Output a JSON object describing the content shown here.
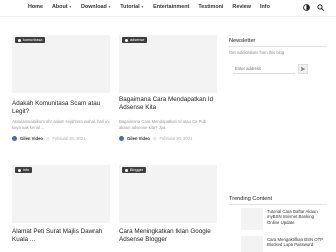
{
  "nav": {
    "items": [
      {
        "label": "Home",
        "dropdown": false
      },
      {
        "label": "About",
        "dropdown": true
      },
      {
        "label": "Download",
        "dropdown": true
      },
      {
        "label": "Tutorial",
        "dropdown": true
      },
      {
        "label": "Entertainment",
        "dropdown": false
      },
      {
        "label": "Testimoni",
        "dropdown": false
      },
      {
        "label": "Review",
        "dropdown": false
      },
      {
        "label": "Info",
        "dropdown": false
      }
    ],
    "icons": [
      "theme-toggle-icon",
      "search-icon"
    ]
  },
  "posts": [
    {
      "tag": "komunitasa",
      "title": "Adakah Komunitasa Scam atau Legit?",
      "excerpt": "Assalamualaikum ahr salam sejahtera wahai. hari ini kaya nak kenal ...",
      "author": "Gilen Video",
      "date": "Februari 20, 2021"
    },
    {
      "tag": "adsense",
      "title": "Bagaimana Cara Mendapatkan Id Adsense Kita",
      "excerpt": "Bagaimana Cara Mendapatkan Id atau Ca Pub akaun adsense kita? Jpa",
      "author": "Gilen Video",
      "date": "Februari 20, 2021"
    },
    {
      "tag": "info",
      "title": "Alamat Peti Surat Majlis Dawrah Kuala ...",
      "excerpt": "",
      "author": "",
      "date": ""
    },
    {
      "tag": "Blogger",
      "title": "Cara Meningkatkan Iklan Google Adsense Blogger",
      "excerpt": "",
      "author": "",
      "date": ""
    }
  ],
  "newsletter": {
    "title": "Newsletter",
    "text": "Get notifications from this blog",
    "placeholder": "Enter address"
  },
  "trending": {
    "title": "Trending Content",
    "items": [
      {
        "title": "Tutorial Cara Daftar Akaun myBSN Internet Banking Online Update"
      },
      {
        "title": "Cara Mengaktifkan BSN OTP Blocked Lupa Password"
      }
    ]
  }
}
